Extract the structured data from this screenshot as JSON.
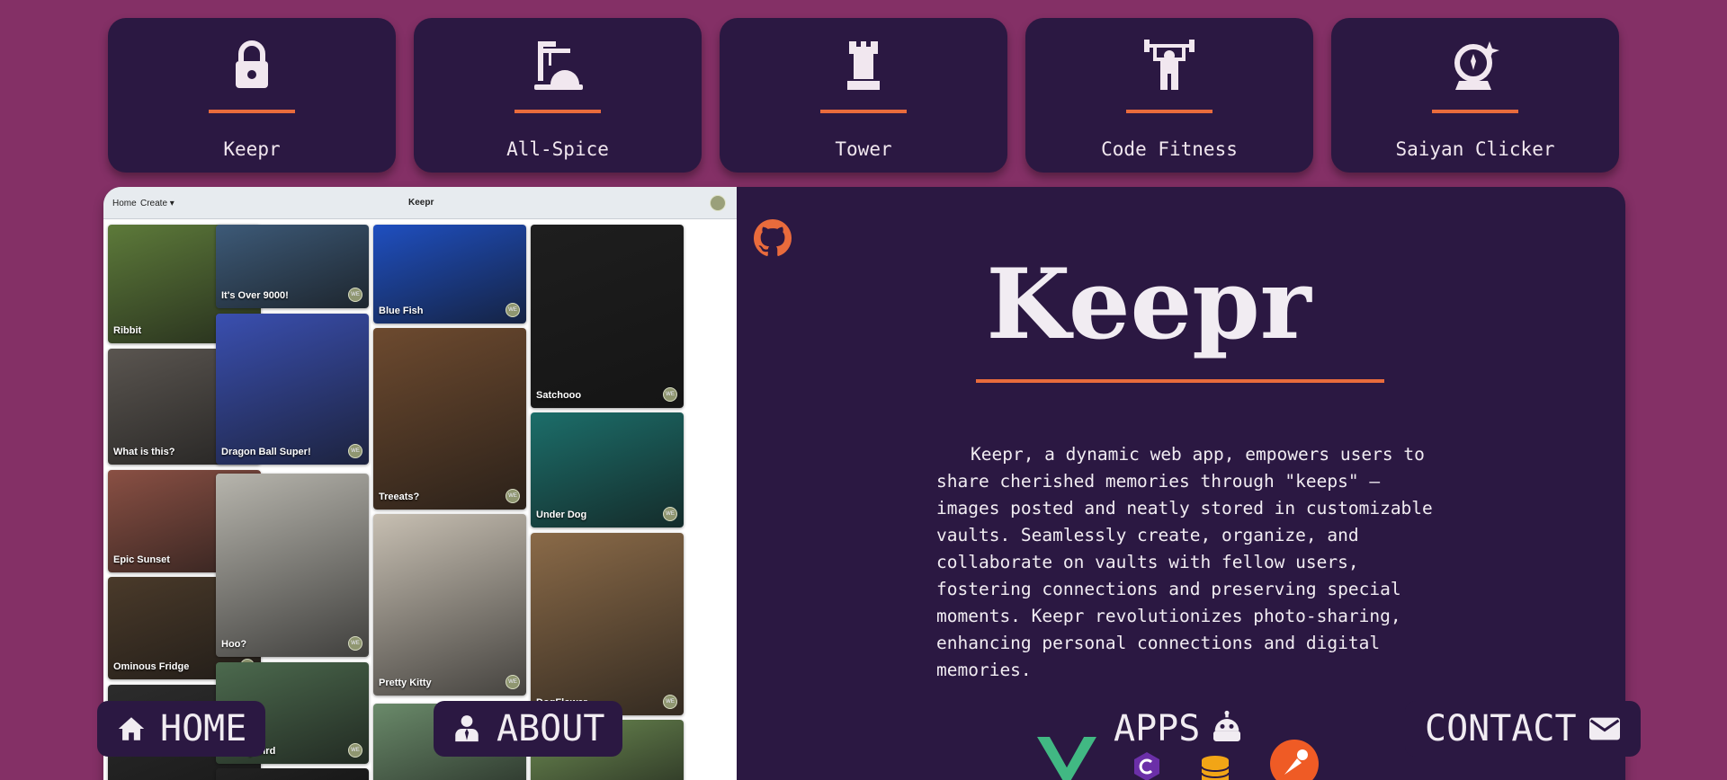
{
  "apps": [
    {
      "label": "Keepr",
      "icon": "lock-icon"
    },
    {
      "label": "All-Spice",
      "icon": "stand-mixer-icon"
    },
    {
      "label": "Tower",
      "icon": "chess-rook-icon"
    },
    {
      "label": "Code Fitness",
      "icon": "weightlifter-icon"
    },
    {
      "label": "Saiyan Clicker",
      "icon": "crystal-ball-icon"
    }
  ],
  "preview": {
    "nav": {
      "home": "Home",
      "create": "Create ▾",
      "brand": "Keepr"
    },
    "keeps": [
      {
        "name": "Ribbit",
        "color": "#5d7a3a"
      },
      {
        "name": "What is this?",
        "color": "#5a5550"
      },
      {
        "name": "Epic Sunset",
        "color": "#8a5044"
      },
      {
        "name": "Ominous Fridge",
        "color": "#4a3a2a"
      },
      {
        "name": "",
        "color": "#2c2c2c"
      },
      {
        "name": "It's Over 9000!",
        "color": "#3d5a78"
      },
      {
        "name": "Dragon Ball Super!",
        "color": "#3a4fb0"
      },
      {
        "name": "Hoo?",
        "color": "#b7b5ad"
      },
      {
        "name": "Tweety bird",
        "color": "#4c6a4e"
      },
      {
        "name": "",
        "color": "#222222"
      },
      {
        "name": "Blue Fish",
        "color": "#1f4fc0"
      },
      {
        "name": "Treeats?",
        "color": "#6d4a2f"
      },
      {
        "name": "Pretty Kitty",
        "color": "#c7bfb2"
      },
      {
        "name": "",
        "color": "#6a8a6a"
      },
      {
        "name": "Satchooo",
        "color": "#1e1e1e"
      },
      {
        "name": "Under Dog",
        "color": "#1c6e6a"
      },
      {
        "name": "DogFlower",
        "color": "#8a6a48"
      },
      {
        "name": "",
        "color": "#6c8a52"
      }
    ],
    "avatar_text": "WE"
  },
  "project": {
    "title": "Keepr",
    "description": "Keepr, a dynamic web app, empowers users to share cherished memories through \"keeps\" — images posted and neatly stored in customizable vaults. Seamlessly create, organize, and collaborate on vaults with fellow users, fostering connections and preserving special moments. Keepr revolutionizes photo-sharing, enhancing personal connections and digital memories.",
    "tech_icons": [
      "vue-icon",
      "csharp-icon",
      "database-icon",
      "postman-icon"
    ]
  },
  "nav": {
    "home": "HOME",
    "about": "ABOUT",
    "apps": "APPS",
    "contact": "CONTACT"
  },
  "colors": {
    "background": "#843066",
    "panel": "#2b1842",
    "accent": "#e96b3c",
    "text": "#f1ecf2"
  }
}
